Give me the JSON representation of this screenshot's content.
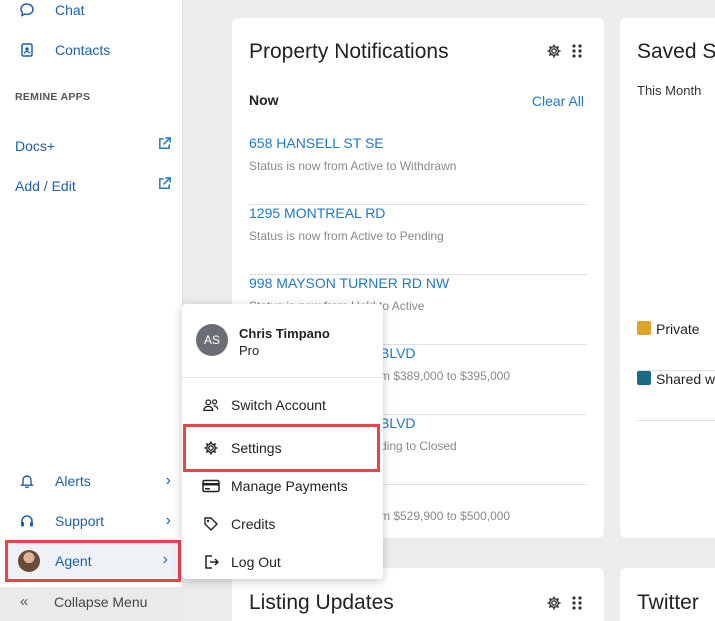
{
  "sidebar": {
    "top_items": [
      {
        "label": "Chat",
        "icon": "chat-bubble-icon"
      },
      {
        "label": "Contacts",
        "icon": "contacts-book-icon"
      }
    ],
    "section_title": "REMINE APPS",
    "apps": [
      {
        "label": "Docs+",
        "icon": "external-link-icon"
      },
      {
        "label": "Add / Edit",
        "icon": "external-link-icon"
      }
    ],
    "bottom_items": [
      {
        "label": "Alerts",
        "icon": "bell-icon"
      },
      {
        "label": "Support",
        "icon": "headset-icon"
      }
    ],
    "agent_label": "Agent",
    "collapse_label": "Collapse Menu"
  },
  "notifications_card": {
    "title": "Property Notifications",
    "section": "Now",
    "clear_all": "Clear All",
    "items": [
      {
        "address": "658 HANSELL ST SE",
        "status": "Status is now from Active to Withdrawn"
      },
      {
        "address": "1295 MONTREAL RD",
        "status": "Status is now from Active to Pending"
      },
      {
        "address": "998 MAYSON TURNER RD NW",
        "status": "Status is now from Hold to Active"
      },
      {
        "address": "BLVD",
        "status": "m $389,000 to $395,000"
      },
      {
        "address": "BLVD",
        "status": "ding to Closed"
      },
      {
        "address": "",
        "status": "m $529,900 to $500,000"
      }
    ]
  },
  "saved_card": {
    "title": "Saved S",
    "subtitle": "This Month",
    "legend": [
      {
        "label": "Private",
        "color": "#e0a42e"
      },
      {
        "label": "Shared w",
        "color": "#1a6a86"
      }
    ]
  },
  "listing_card": {
    "title": "Listing Updates"
  },
  "twitter_card": {
    "title": "Twitter"
  },
  "user_menu": {
    "initials": "AS",
    "name": "Chris Timpano",
    "tier": "Pro",
    "items": [
      {
        "label": "Switch Account",
        "icon": "users-icon"
      },
      {
        "label": "Settings",
        "icon": "gear-icon"
      },
      {
        "label": "Manage Payments",
        "icon": "credit-card-icon"
      },
      {
        "label": "Credits",
        "icon": "tag-icon"
      },
      {
        "label": "Log Out",
        "icon": "logout-icon"
      }
    ]
  },
  "colors": {
    "accent": "#1f78c8",
    "highlight": "#e8454a"
  }
}
